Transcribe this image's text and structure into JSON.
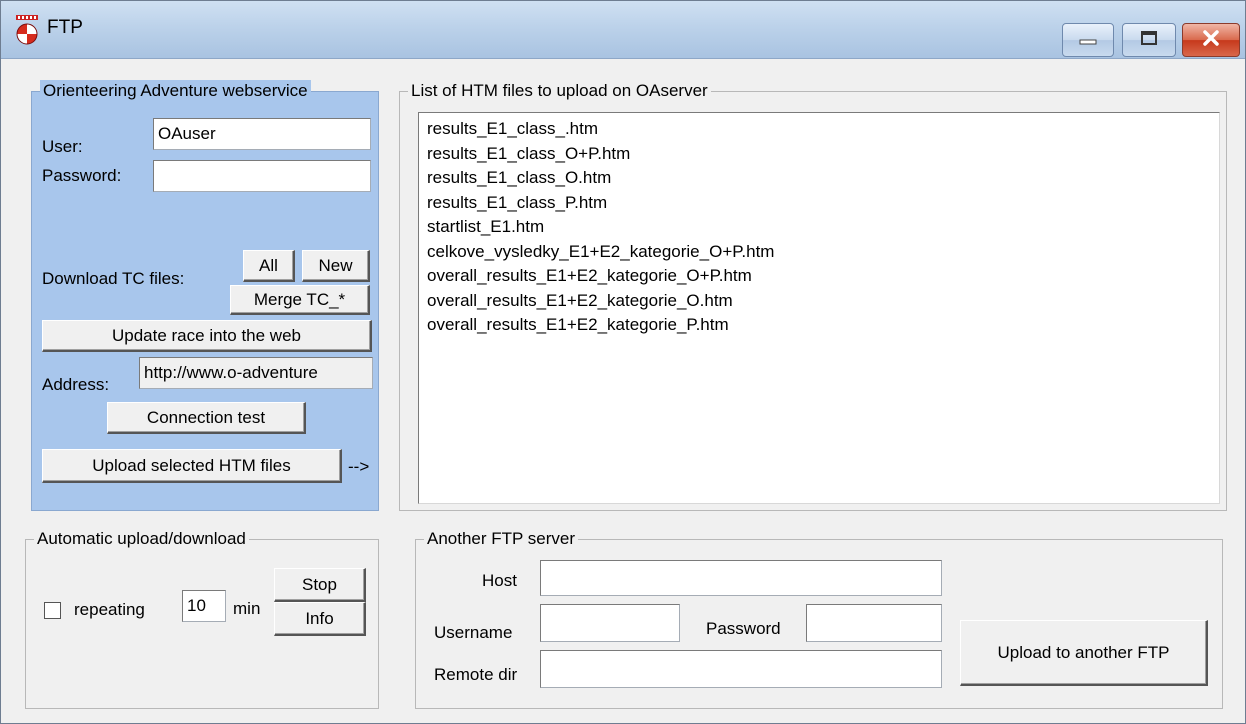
{
  "window": {
    "title": "FTP"
  },
  "oa_group": {
    "legend": "Orienteering Adventure webservice",
    "user_label": "User:",
    "user_value": "OAuser",
    "password_label": "Password:",
    "password_value": "",
    "download_label": "Download TC files:",
    "all_button": "All",
    "new_button": "New",
    "merge_button": "Merge TC_*",
    "update_button": "Update race into the web",
    "address_label": "Address:",
    "address_value": "http://www.o-adventure",
    "connection_test_button": "Connection test",
    "upload_selected_button": "Upload selected HTM files",
    "arrow_text": "-->"
  },
  "file_list": {
    "legend": "List of HTM files to upload on OAserver",
    "items": [
      "results_E1_class_.htm",
      "results_E1_class_O+P.htm",
      "results_E1_class_O.htm",
      "results_E1_class_P.htm",
      "startlist_E1.htm",
      "celkove_vysledky_E1+E2_kategorie_O+P.htm",
      "overall_results_E1+E2_kategorie_O+P.htm",
      "overall_results_E1+E2_kategorie_O.htm",
      "overall_results_E1+E2_kategorie_P.htm"
    ]
  },
  "auto_group": {
    "legend": "Automatic upload/download",
    "repeating_label": "repeating",
    "interval_value": "10",
    "min_label": "min",
    "stop_button": "Stop",
    "info_button": "Info"
  },
  "ftp_group": {
    "legend": "Another FTP server",
    "host_label": "Host",
    "host_value": "",
    "username_label": "Username",
    "username_value": "",
    "password_label": "Password",
    "password_value": "",
    "remote_dir_label": "Remote dir",
    "remote_dir_value": "",
    "upload_button": "Upload to another FTP"
  },
  "colors": {
    "oa_panel_background": "#a8c6ec",
    "titlebar": "#bcd2ea",
    "close_button": "#c6391c"
  },
  "icons": [
    "app-icon",
    "minimize-icon",
    "maximize-icon",
    "close-icon"
  ]
}
